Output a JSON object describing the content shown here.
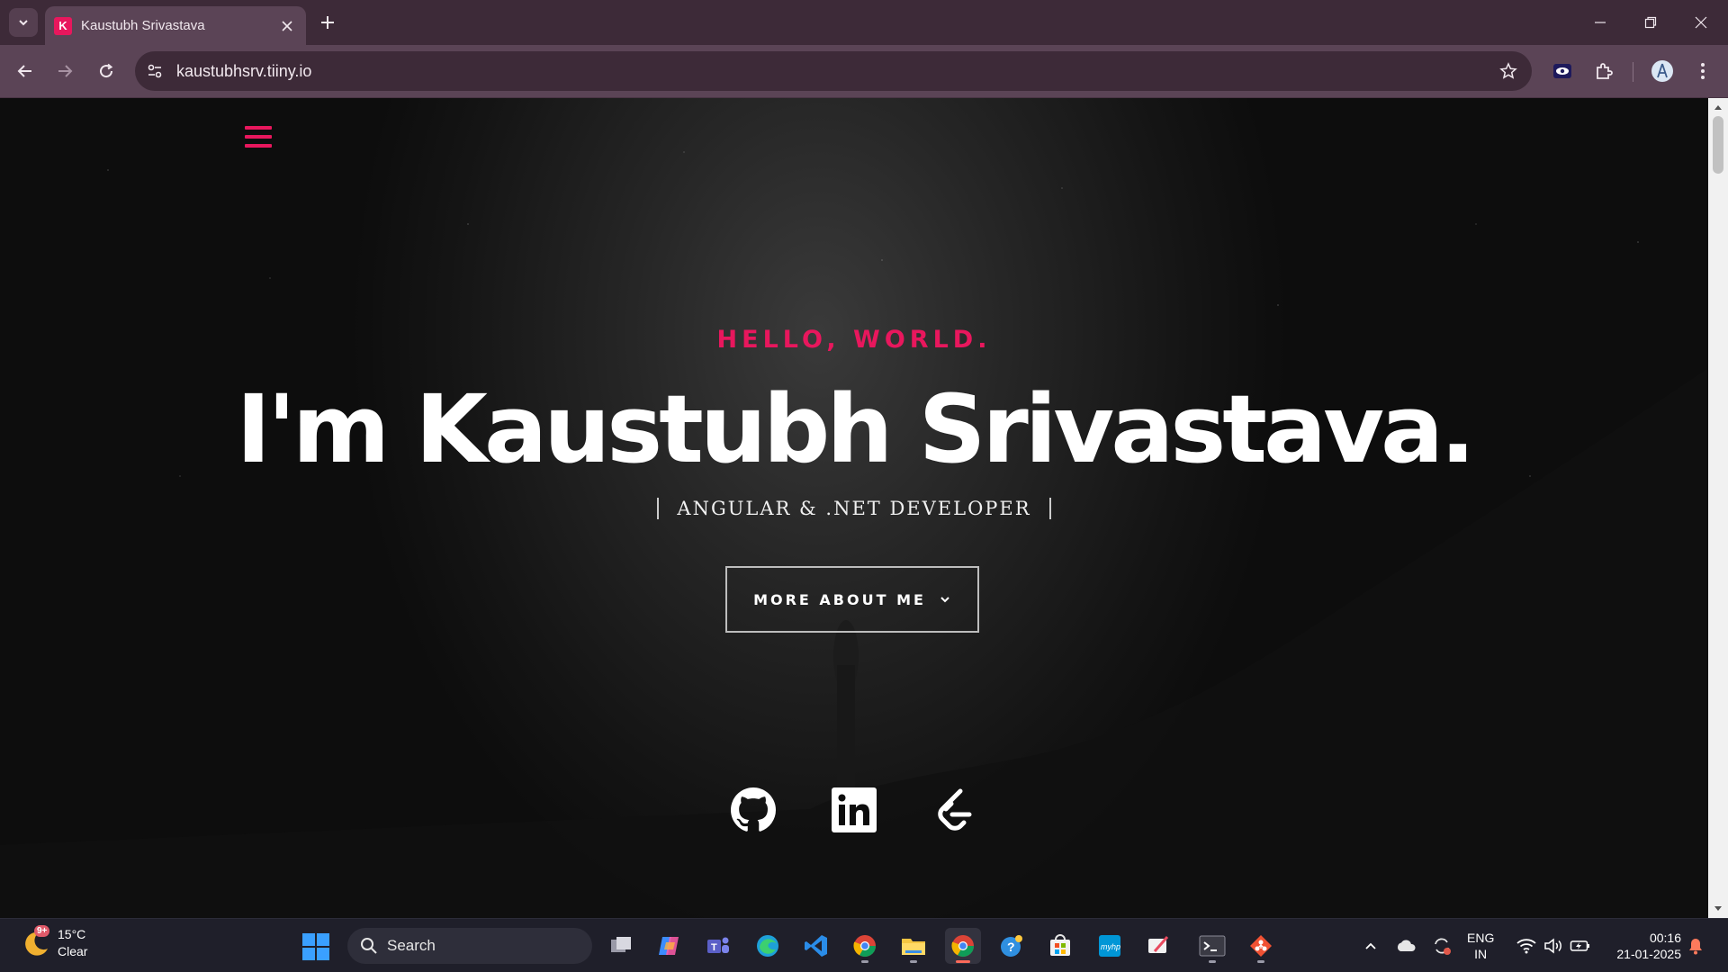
{
  "browser": {
    "tab_title": "Kaustubh Srivastava",
    "tab_favicon_letter": "K",
    "url": "kaustubhsrv.tiiny.io"
  },
  "page": {
    "greeting": "HELLO, WORLD.",
    "headline": "I'm Kaustubh Srivastava.",
    "role": "ANGULAR & .NET DEVELOPER",
    "more_button": "MORE ABOUT ME",
    "socials": [
      "github-icon",
      "linkedin-icon",
      "leetcode-icon"
    ],
    "accent_color": "#e8175d"
  },
  "taskbar": {
    "weather_badge": "9+",
    "temperature": "15°C",
    "condition": "Clear",
    "search_label": "Search",
    "lang_line1": "ENG",
    "lang_line2": "IN",
    "time": "00:16",
    "date": "21-01-2025"
  }
}
